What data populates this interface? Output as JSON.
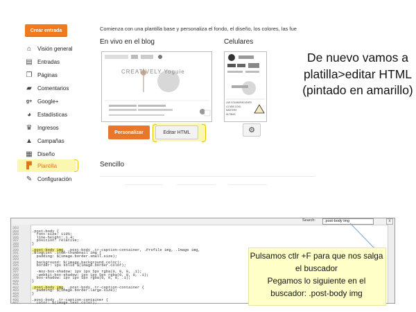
{
  "blogger": {
    "create_button": "Crear entrada",
    "nav": [
      {
        "label": "Visión general",
        "icon": "home-icon"
      },
      {
        "label": "Entradas",
        "icon": "posts-icon"
      },
      {
        "label": "Páginas",
        "icon": "pages-icon"
      },
      {
        "label": "Comentarios",
        "icon": "comments-icon"
      },
      {
        "label": "Google+",
        "icon": "google-plus-icon"
      },
      {
        "label": "Estadísticas",
        "icon": "stats-icon"
      },
      {
        "label": "Ingresos",
        "icon": "trophy-icon"
      },
      {
        "label": "Campañas",
        "icon": "campaigns-icon"
      },
      {
        "label": "Diseño",
        "icon": "layout-icon"
      },
      {
        "label": "Plantilla",
        "icon": "template-icon"
      },
      {
        "label": "Configuración",
        "icon": "wrench-icon"
      }
    ],
    "intro_text": "Comienza con una plantilla base y personaliza el fondo, el diseño, los colores, las fue",
    "live_title": "En vivo en el blog",
    "mobile_title": "Celulares",
    "customize_button": "Personalizar",
    "edit_html_button": "Editar HTML",
    "simple_title": "Sencillo",
    "preview_blog_name": "CREATIVELY Yoguie",
    "mobile_snippet": [
      "LAS COLABORACIONES",
      "LO MÁS COOL",
      "MÁSTERS",
      "ÚLTIMAS"
    ]
  },
  "annotation_top": "De nuevo vamos a platilla>editar HTML (pintado en amarillo)",
  "editor": {
    "search_label": "Search:",
    "search_value": ".post-body img",
    "close_label": "x",
    "line_numbers": [
      "383",
      "384",
      "385",
      "386",
      "387",
      "388",
      "389",
      "390",
      "391",
      "392",
      "393",
      "394",
      "395",
      "396",
      "397",
      "398",
      "399",
      "400",
      "401",
      "402",
      "403",
      "404",
      "405",
      "406",
      "407"
    ],
    "lines": [
      "",
      ".post-body {",
      "  font-size: 110%;",
      "  line-height: 1.4;",
      "  position: relative;",
      "}",
      "",
      ".post-body img, .post-body .tr-caption-container, .Profile img, .Image img,",
      ".BlogList .item-thumbnail img {",
      "  padding: $(image.border.small.size);",
      "",
      "  background: $(image.background.color);",
      "  border: 1px solid $(image.border.color);",
      "",
      "  -moz-box-shadow: 1px 1px 5px rgba(0, 0, 0, .1);",
      "  -webkit-box-shadow: 1px 1px 5px rgba(0, 0, 0, .1);",
      "  box-shadow: 1px 1px 5px rgba(0, 0, 0, .1);",
      "}",
      "",
      ".post-body img, .post-body .tr-caption-container {",
      "  padding: $(image.border.large.size);",
      "}",
      "",
      ".post-body .tr-caption-container {",
      "  color: $(image.text.color);"
    ]
  },
  "annotation_bottom": {
    "line1": "Pulsamos ctlr +F para que nos salga el buscador",
    "line2": "Pegamos lo siguiente en el buscador: .post-body img"
  },
  "colors": {
    "accent_orange": "#f07b1e",
    "highlight_yellow": "#fbf7b0",
    "callout_bg": "#ffffc8"
  }
}
